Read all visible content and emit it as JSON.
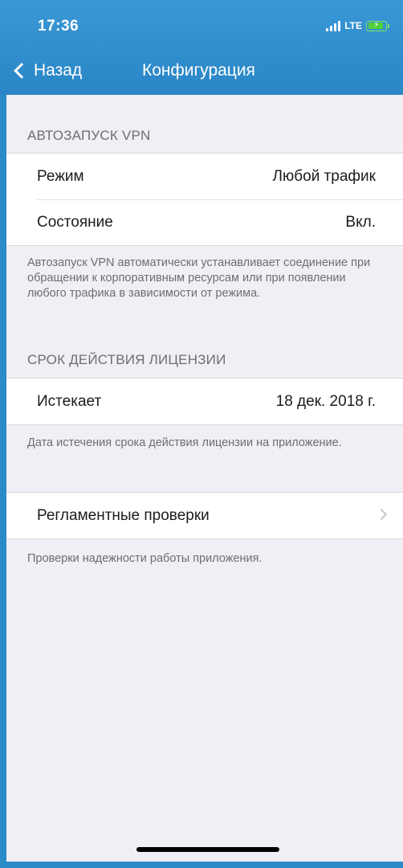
{
  "status_bar": {
    "time": "17:36",
    "network": "LTE",
    "battery_icon": "battery-charging-icon",
    "signal_icon": "signal-bars-icon"
  },
  "nav": {
    "back_label": "Назад",
    "title": "Конфигурация"
  },
  "sections": {
    "autostart": {
      "header": "АВТОЗАПУСК VPN",
      "rows": [
        {
          "title": "Режим",
          "value": "Любой трафик"
        },
        {
          "title": "Состояние",
          "value": "Вкл."
        }
      ],
      "footer": "Автозапуск VPN автоматически устанавливает соединение при обращении к корпоративным ресурсам или при появлении любого трафика в зависимости от режима."
    },
    "license": {
      "header": "СРОК ДЕЙСТВИЯ ЛИЦЕНЗИИ",
      "rows": [
        {
          "title": "Истекает",
          "value": "18 дек. 2018 г."
        }
      ],
      "footer": "Дата истечения срока действия лицензии на приложение."
    },
    "checks": {
      "rows": [
        {
          "title": "Регламентные проверки"
        }
      ],
      "footer": "Проверки надежности работы приложения."
    }
  },
  "colors": {
    "accent": "#2a8bc9",
    "background": "#f0eff5",
    "secondary_text": "#6d6d72"
  }
}
